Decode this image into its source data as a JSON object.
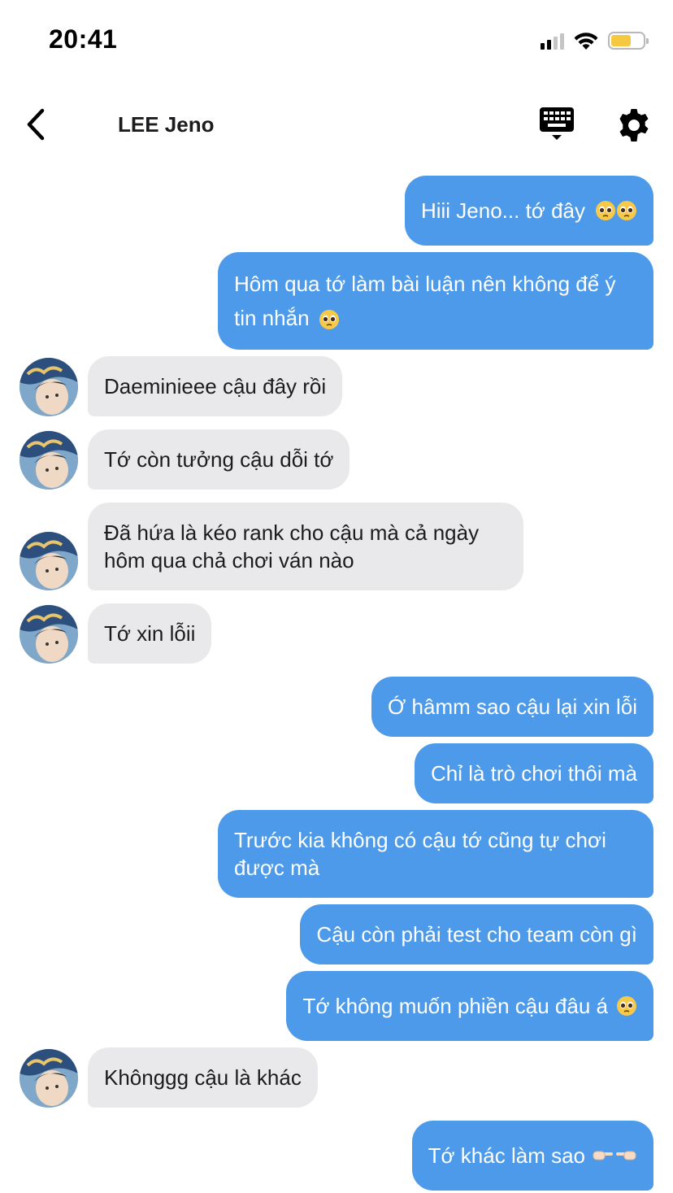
{
  "status_bar": {
    "time": "20:41",
    "battery_color": "#f5c842"
  },
  "header": {
    "title": "LEE Jeno",
    "back_icon": "chevron-left-icon",
    "keyboard_icon": "keyboard-icon",
    "settings_icon": "gear-icon"
  },
  "colors": {
    "outgoing_bubble": "#4c9ae9",
    "incoming_bubble": "#e9e9eb"
  },
  "messages": [
    {
      "from": "me",
      "text": "Hiii Jeno... tớ đây",
      "emoji": "pleading-face-icon ×2"
    },
    {
      "from": "me",
      "text": "Hôm qua tớ làm bài luận nên không để ý tin nhắn",
      "emoji": "pleading-face-icon"
    },
    {
      "from": "Jeno",
      "text": "Daeminieee cậu đây rồi"
    },
    {
      "from": "Jeno",
      "text": "Tớ còn tưởng cậu dỗi tớ"
    },
    {
      "from": "Jeno",
      "text": "Đã hứa là kéo rank cho cậu mà cả ngày hôm qua chả chơi ván nào"
    },
    {
      "from": "Jeno",
      "text": "Tớ xin lỗii"
    },
    {
      "from": "me",
      "text": "Ớ hâmm sao cậu lại xin lỗi"
    },
    {
      "from": "me",
      "text": "Chỉ là trò chơi thôi mà"
    },
    {
      "from": "me",
      "text": "Trước kia không có cậu tớ cũng tự chơi được mà"
    },
    {
      "from": "me",
      "text": "Cậu còn phải test cho team còn gì"
    },
    {
      "from": "me",
      "text": "Tớ không muốn phiền cậu đâu á",
      "emoji": "pleading-face-icon"
    },
    {
      "from": "Jeno",
      "text": "Khônggg cậu là khác"
    },
    {
      "from": "me",
      "text": "Tớ khác làm sao",
      "emoji": "index-pointing-icon ×2"
    }
  ]
}
